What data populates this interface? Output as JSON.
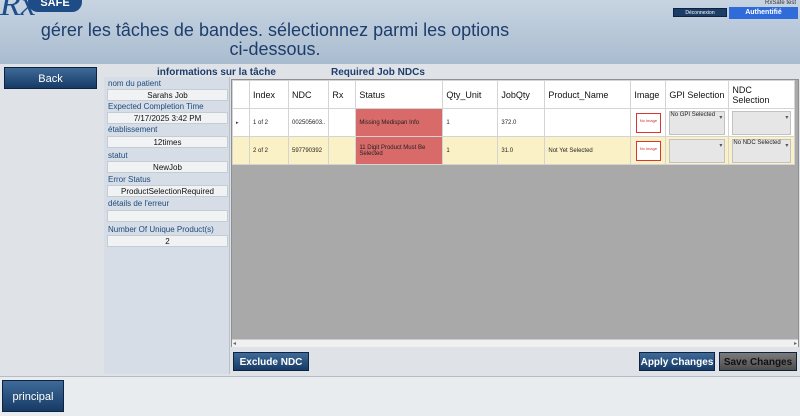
{
  "header": {
    "logo_rx": "Rx",
    "logo_safe": "SAFE",
    "title": "gérer les tâches de bandes. sélectionnez parmi les options ci-dessous.",
    "user_label": "RxSafe test",
    "deconnexion_label": "Déconnexion",
    "auth_label": "Authentifié"
  },
  "back_label": "Back",
  "task_info": {
    "heading": "informations sur la tâche",
    "patient_label": "nom du patient",
    "patient_value": "Sarahs Job",
    "completion_label": "Expected Completion Time",
    "completion_value": "7/17/2025 3:42 PM",
    "facility_label": "établissement",
    "facility_value": "12times",
    "status_label": "statut",
    "status_value": "NewJob",
    "error_status_label": "Error Status",
    "error_status_value": "ProductSelectionRequired",
    "error_details_label": "détails de l'erreur",
    "error_details_value": "",
    "unique_products_label": "Number Of Unique Product(s)",
    "unique_products_value": "2"
  },
  "ndc_grid": {
    "heading": "Required Job NDCs",
    "columns": [
      "Index",
      "NDC",
      "Rx",
      "Status",
      "Qty_Unit",
      "JobQty",
      "Product_Name",
      "Image",
      "GPI Selection",
      "NDC Selection"
    ],
    "rows": [
      {
        "index": "1 of 2",
        "ndc": "002505603..",
        "rx": "",
        "status": "Missing Medispan Info",
        "qty_unit": "1",
        "job_qty": "372.0",
        "product_name": "",
        "image": "No Image",
        "gpi_selection": "No GPI Selected",
        "ndc_selection": ""
      },
      {
        "index": "2 of 2",
        "ndc": "597790392",
        "rx": "",
        "status": "11 Digit Product Must Be Selected",
        "qty_unit": "1",
        "job_qty": "31.0",
        "product_name": "Not Yet Selected",
        "image": "No Image",
        "gpi_selection": "",
        "ndc_selection": "No NDC Selected"
      }
    ]
  },
  "buttons": {
    "exclude_ndc": "Exclude NDC",
    "apply_changes": "Apply Changes",
    "save_changes": "Save Changes",
    "principal": "principal"
  },
  "colors": {
    "status_error": "#d96a6a",
    "row_highlight": "#fbf1c6",
    "button_blue": "#163a65",
    "auth_blue": "#2f6cd9"
  }
}
